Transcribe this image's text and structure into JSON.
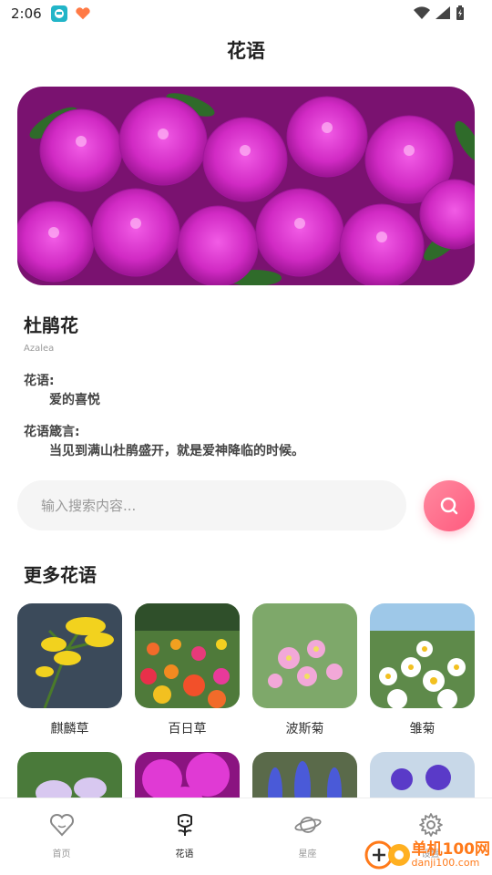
{
  "status_bar": {
    "time": "2:06"
  },
  "header": {
    "title": "花语"
  },
  "featured": {
    "name": "杜鹃花",
    "latin": "Azalea",
    "meaning_label": "花语:",
    "meaning": "爱的喜悦",
    "motto_label": "花语箴言:",
    "motto": "当见到满山杜鹃盛开，就是爱神降临的时候。"
  },
  "search": {
    "placeholder": "输入搜索内容..."
  },
  "more": {
    "title": "更多花语",
    "items": [
      {
        "label": "麒麟草"
      },
      {
        "label": "百日草"
      },
      {
        "label": "波斯菊"
      },
      {
        "label": "雏菊"
      },
      {
        "label": ""
      },
      {
        "label": ""
      },
      {
        "label": ""
      },
      {
        "label": ""
      }
    ]
  },
  "tabs": [
    {
      "label": "首页",
      "icon": "heart-icon"
    },
    {
      "label": "花语",
      "icon": "flower-icon"
    },
    {
      "label": "星座",
      "icon": "planet-icon"
    },
    {
      "label": "设置",
      "icon": "gear-icon"
    }
  ],
  "watermark": {
    "text": "单机100网",
    "url": "danji100.com"
  },
  "colors": {
    "accent": "#ff5a7e",
    "hero": "#c21fb5"
  }
}
